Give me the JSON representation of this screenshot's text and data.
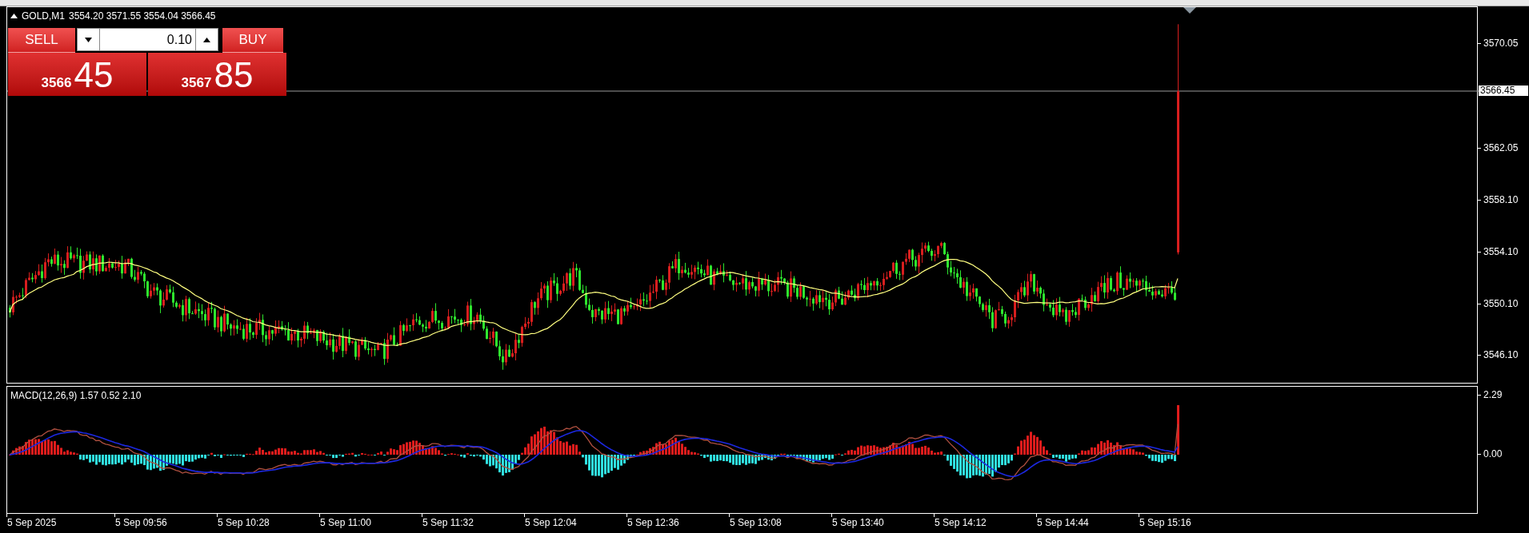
{
  "chart": {
    "symbol": "GOLD,M1",
    "ohlc": "3554.20 3571.55 3554.04 3566.45"
  },
  "trade_panel": {
    "sell_label": "SELL",
    "buy_label": "BUY",
    "lot": "0.10",
    "bid": {
      "prefix": "3566",
      "pips": "45"
    },
    "ask": {
      "prefix": "3567",
      "pips": "85"
    }
  },
  "price_axis": {
    "labels": [
      "3570.05",
      "3562.05",
      "3558.10",
      "3554.10",
      "3550.10",
      "3546.10"
    ],
    "current_price": "3566.45"
  },
  "macd": {
    "label": "MACD(12,26,9) 1.57 0.52 2.10",
    "axis_labels": [
      "2.29",
      "0.00"
    ]
  },
  "time_axis": {
    "labels": [
      "5 Sep 2025",
      "5 Sep 09:56",
      "5 Sep 10:28",
      "5 Sep 11:00",
      "5 Sep 11:32",
      "5 Sep 12:04",
      "5 Sep 12:36",
      "5 Sep 13:08",
      "5 Sep 13:40",
      "5 Sep 14:12",
      "5 Sep 14:44",
      "5 Sep 15:16"
    ]
  }
}
